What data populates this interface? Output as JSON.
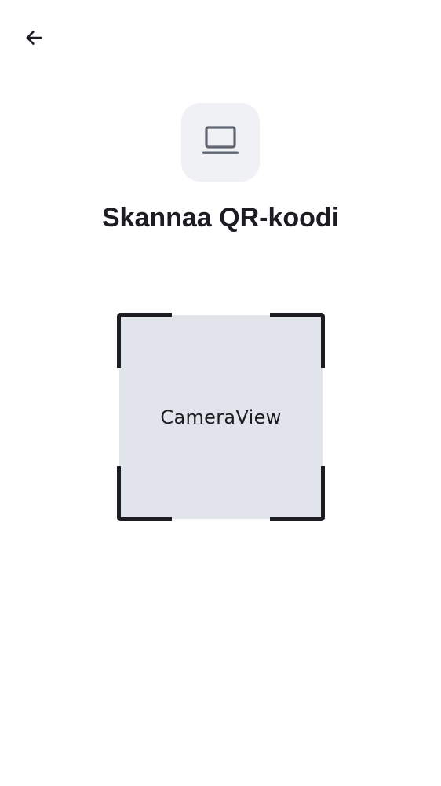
{
  "header": {
    "back_icon": "arrow-left-icon"
  },
  "badge": {
    "icon": "laptop-icon"
  },
  "title": "Skannaa QR-koodi",
  "scanner": {
    "camera_label": "CameraView"
  },
  "colors": {
    "text": "#1c1c22",
    "badge_bg": "#f0f1f5",
    "camera_bg": "#e1e5eb",
    "icon_gray": "#5f6672"
  }
}
